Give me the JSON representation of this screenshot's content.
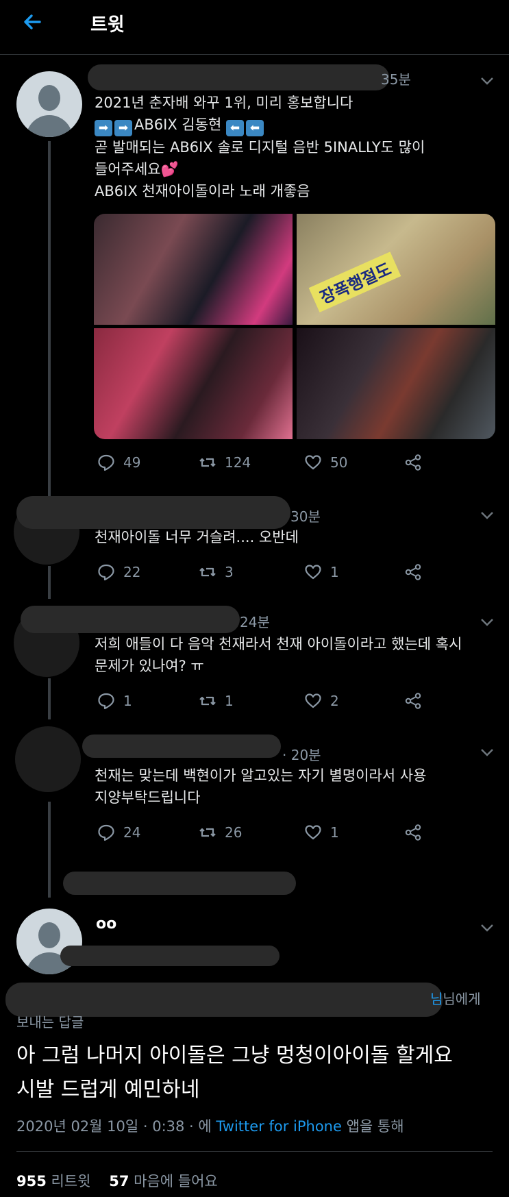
{
  "header": {
    "title": "트윗"
  },
  "tweet": {
    "time": "35분",
    "lines": [
      "2021년 춘자배 와꾸 1위, 미리 홍보합니다",
      "AB6IX 김동현",
      "곧 발매되는 AB6IX 솔로 디지털 음반 5INALLY도 많이",
      "들어주세요",
      "AB6IX 천재아이돌이라 노래 개좋음"
    ],
    "photo_sign": "장폭행절도",
    "replies": "49",
    "retweets": "124",
    "likes": "50"
  },
  "replies": [
    {
      "time": "30분",
      "lines": [
        "천재아이돌 너무 거슬려.... 오반데"
      ],
      "replies": "22",
      "retweets": "3",
      "likes": "1"
    },
    {
      "time": "24분",
      "lines": [
        "저희 애들이 다 음악 천재라서 천재 아이돌이라고 했는데 혹시",
        "문제가 있나여? ㅠ"
      ],
      "replies": "1",
      "retweets": "1",
      "likes": "2"
    },
    {
      "time": "· 20분",
      "lines": [
        "천재는 맞는데 백현이가 알고있는 자기 별명이라서 사용",
        "지양부탁드립니다"
      ],
      "replies": "24",
      "retweets": "26",
      "likes": "1"
    }
  ],
  "main": {
    "name": "oo",
    "mention_suffix": "님에게",
    "mention_partial": "님",
    "reply_label": "보내는 답글",
    "lines": [
      "아 그럼 나머지 아이돌은 그냥 멍청이아이돌 할게요",
      "시발 드럽게 예민하네"
    ],
    "date": "2020년 02월 10일 · 0:38 · 에",
    "source": "Twitter for iPhone",
    "via": "앱을 통해",
    "retweet_count": "955",
    "retweet_label": "리트윗",
    "like_count": "57",
    "like_label": "마음에 들어요"
  },
  "colors": {
    "accent": "#1d9bf0",
    "muted": "#8b98a5",
    "background": "#000000"
  }
}
